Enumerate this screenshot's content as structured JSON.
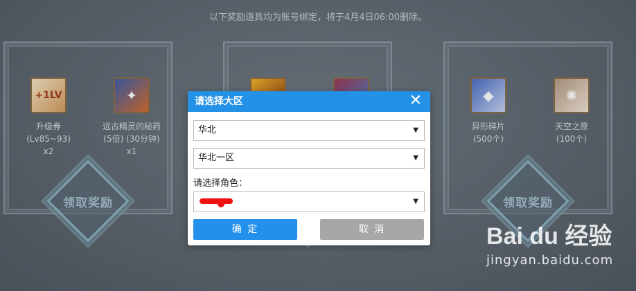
{
  "notice": "以下奖励道具均为账号绑定，将于4月4日06:00删除。",
  "panels": [
    {
      "items": [
        {
          "icon": "level-up-scroll-icon",
          "icon_text": "+1LV",
          "name": "升级券",
          "detail": "(Lv85~93)",
          "count": "x2"
        },
        {
          "icon": "ancient-elf-potion-icon",
          "icon_text": "",
          "name": "远古精灵的秘药",
          "detail": "(5倍) (30分钟)",
          "count": "x1"
        }
      ],
      "claim_label": "领取奖励"
    },
    {
      "items": [
        {
          "icon": "fire-item-icon",
          "icon_text": "",
          "name": "",
          "detail": "",
          "count": ""
        },
        {
          "icon": "blue-item-icon",
          "icon_text": "",
          "name": "",
          "detail": "",
          "count": ""
        }
      ],
      "claim_label": ""
    },
    {
      "items": [
        {
          "icon": "shard-icon",
          "icon_text": "",
          "name": "异形碎片",
          "detail": "(500个)",
          "count": ""
        },
        {
          "icon": "sky-origin-icon",
          "icon_text": "",
          "name": "天空之原",
          "detail": "(100个)",
          "count": ""
        }
      ],
      "claim_label": "领取奖励"
    }
  ],
  "dialog": {
    "title": "请选择大区",
    "close_symbol": "✕",
    "region_value": "华北",
    "server_value": "华北一区",
    "role_label": "请选择角色：",
    "role_value": "",
    "dropdown_arrow": "▼",
    "confirm_label": "确 定",
    "cancel_label": "取 消"
  },
  "watermark": {
    "logo": "Bai du 经验",
    "url": "jingyan.baidu.com"
  },
  "colors": {
    "dialog_header": "#2291e6",
    "confirm_button": "#2390ec",
    "cancel_button": "#a7a7a7",
    "redaction": "#ee1111"
  }
}
